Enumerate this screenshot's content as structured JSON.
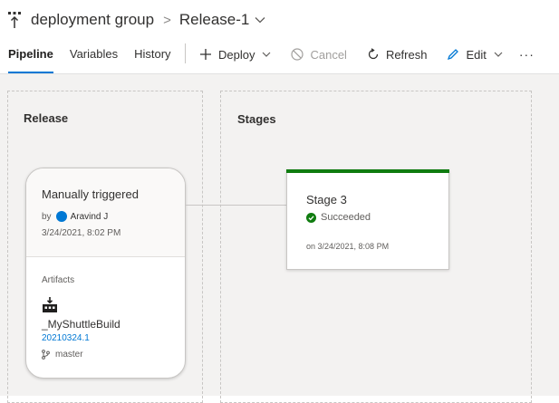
{
  "breadcrumb": {
    "icon": "pipeline-icon",
    "group": "deployment group",
    "separator": ">",
    "release": "Release-1"
  },
  "tabs": [
    {
      "label": "Pipeline",
      "active": true
    },
    {
      "label": "Variables",
      "active": false
    },
    {
      "label": "History",
      "active": false
    }
  ],
  "toolbar": {
    "deploy": "Deploy",
    "cancel": "Cancel",
    "refresh": "Refresh",
    "edit": "Edit",
    "more": "···"
  },
  "lanes": {
    "release_title": "Release",
    "stages_title": "Stages"
  },
  "release_card": {
    "trigger": "Manually triggered",
    "by_label": "by",
    "user": "Aravind J",
    "date": "3/24/2021, 8:02 PM",
    "artifacts_label": "Artifacts",
    "build_name": "_MyShuttleBuild",
    "build_version": "20210324.1",
    "branch": "master"
  },
  "stage_card": {
    "name": "Stage 3",
    "status": "Succeeded",
    "date": "on 3/24/2021, 8:08 PM"
  },
  "colors": {
    "accent": "#0078d4",
    "success": "#107c10",
    "canvas_bg": "#f3f2f1"
  }
}
